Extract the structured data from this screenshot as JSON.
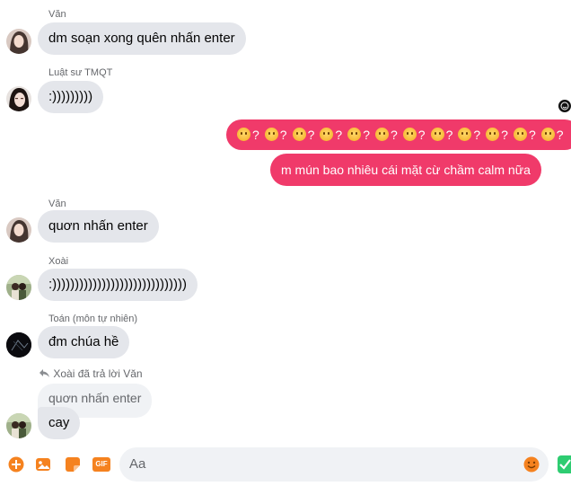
{
  "messages": [
    {
      "sender": "Văn",
      "text": "dm soạn xong quên nhấn enter"
    },
    {
      "sender": "Luật sư TMQT",
      "text": ":)))))))))"
    },
    {
      "sender": "Văn",
      "text": "quơn nhấn enter"
    },
    {
      "sender": "Xoài",
      "text": ":))))))))))))))))))))))))))))))"
    },
    {
      "sender": "Toán (môn tự nhiên)",
      "text": "đm chúa hề"
    }
  ],
  "outgoing": {
    "emoji_row_suffix": "?",
    "emoji_count": 12,
    "text": "m mún bao nhiêu cái mặt cừ chầm calm nữa"
  },
  "reply": {
    "label": "Xoài đã trả lời Văn",
    "quoted_text": "quơn nhấn enter",
    "text": "cay"
  },
  "composer": {
    "placeholder": "Aa",
    "gif_label": "GIF"
  },
  "colors": {
    "accent": "#f5821f",
    "outgoing_bubble": "#f03a6a",
    "incoming_bubble": "#e4e6eb",
    "send_green": "#2ecc71"
  },
  "icons": [
    "plus-circle-icon",
    "image-icon",
    "sticker-icon",
    "gif-icon",
    "emoji-icon",
    "send-check-icon",
    "seen-avatar-icon",
    "reply-arrow-icon"
  ]
}
